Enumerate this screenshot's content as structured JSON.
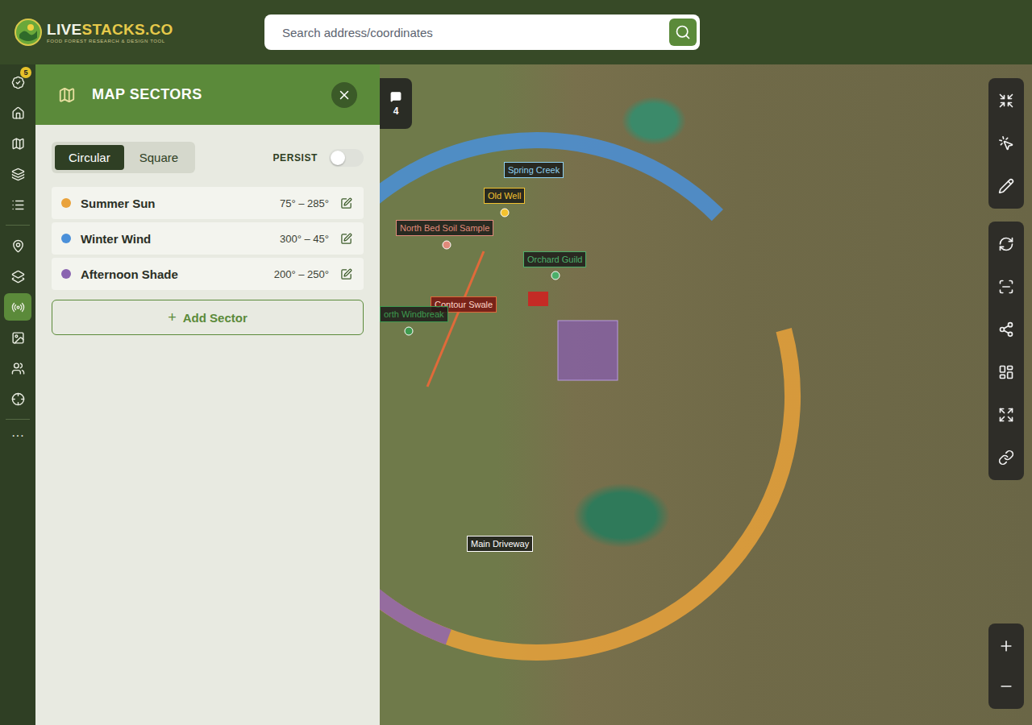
{
  "header": {
    "logo": {
      "primary": "LIVE",
      "secondary": "STACKS.CO",
      "tagline": "FOOD FOREST RESEARCH & DESIGN TOOL"
    },
    "search": {
      "placeholder": "Search address/coordinates"
    }
  },
  "rail": {
    "items": [
      {
        "badge": "5",
        "selected": false
      },
      {
        "badge": "",
        "selected": false
      },
      {
        "badge": "",
        "selected": false
      },
      {
        "badge": "",
        "selected": false
      },
      {
        "badge": "",
        "selected": false
      },
      {
        "badge": "",
        "selected": false
      },
      {
        "badge": "",
        "selected": false
      },
      {
        "badge": "",
        "selected": true
      },
      {
        "badge": "",
        "selected": false
      },
      {
        "badge": "",
        "selected": false
      },
      {
        "badge": "",
        "selected": false
      }
    ],
    "more": "···"
  },
  "panel": {
    "title": "MAP SECTORS",
    "modes": [
      {
        "label": "Circular",
        "selected": true
      },
      {
        "label": "Square",
        "selected": false
      }
    ],
    "persist": {
      "label": "PERSIST",
      "on": false
    },
    "sectors": [
      {
        "name": "Summer Sun",
        "range": "75° – 285°",
        "from": 75,
        "to": 285,
        "color": "#e9a23b"
      },
      {
        "name": "Winter Wind",
        "range": "300° – 45°",
        "from": 300,
        "to": 45,
        "color": "#4a90d9"
      },
      {
        "name": "Afternoon Shade",
        "range": "200° – 250°",
        "from": 200,
        "to": 250,
        "color": "#8a64b0"
      }
    ],
    "add_button": {
      "icon": "+",
      "label": "Add Sector"
    }
  },
  "map": {
    "comments": {
      "count": "4"
    },
    "markers": [
      {
        "label": "Spring Creek",
        "kind": "label",
        "color": "#8fd0f0"
      },
      {
        "label": "Old Well",
        "kind": "pin",
        "color": "#f2c230"
      },
      {
        "label": "North Bed Soil Sample",
        "kind": "pin",
        "color": "#e08a7a"
      },
      {
        "label": "Orchard Guild",
        "kind": "pin",
        "color": "#4caf6a"
      },
      {
        "label": "Contour Swale",
        "kind": "line",
        "color": "#e06a3a"
      },
      {
        "label": "orth Windbreak",
        "kind": "pin",
        "color": "#3f9a4f"
      },
      {
        "label": "Main Driveway",
        "kind": "label",
        "color": "#ffffff"
      }
    ]
  }
}
